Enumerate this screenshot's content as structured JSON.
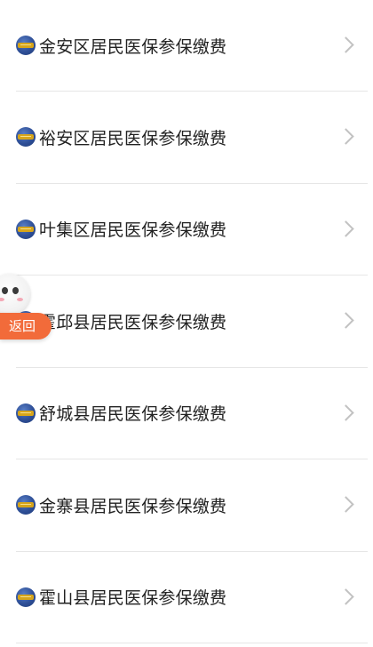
{
  "list": {
    "items": [
      {
        "label": "金安区居民医保参保缴费",
        "icon": "chis-logo-icon"
      },
      {
        "label": "裕安区居民医保参保缴费",
        "icon": "chis-logo-icon"
      },
      {
        "label": "叶集区居民医保参保缴费",
        "icon": "chis-logo-icon"
      },
      {
        "label": "霍邱县居民医保参保缴费",
        "icon": "chis-logo-icon"
      },
      {
        "label": "舒城县居民医保参保缴费",
        "icon": "chis-logo-icon"
      },
      {
        "label": "金寨县居民医保参保缴费",
        "icon": "chis-logo-icon"
      },
      {
        "label": "霍山县居民医保参保缴费",
        "icon": "chis-logo-icon"
      }
    ]
  },
  "float_button": {
    "label": "返回",
    "color": "#f26b3a"
  }
}
